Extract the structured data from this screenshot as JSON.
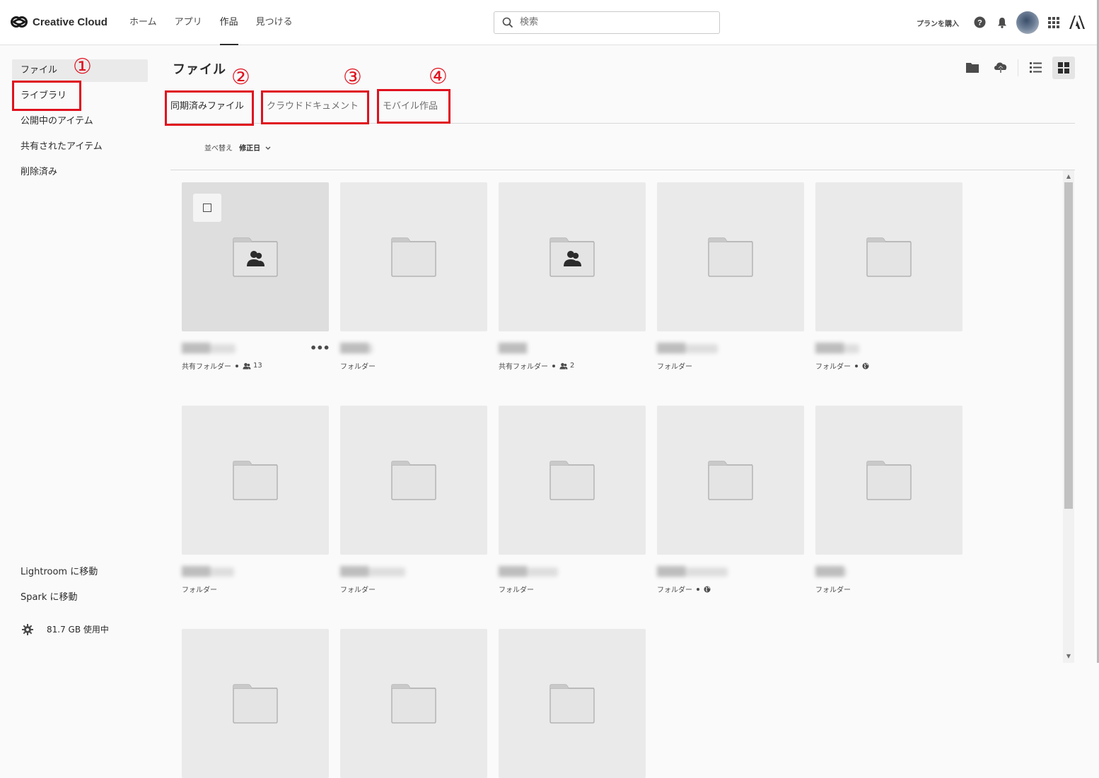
{
  "app": {
    "title": "Creative Cloud",
    "nav": [
      {
        "label": "ホーム",
        "active": false
      },
      {
        "label": "アプリ",
        "active": false
      },
      {
        "label": "作品",
        "active": true
      },
      {
        "label": "見つける",
        "active": false
      }
    ],
    "search_placeholder": "検索",
    "buy_plan_label": "プランを購入",
    "header_icons": [
      "help-icon",
      "bell-icon",
      "avatar",
      "apps-grid-icon",
      "adobe-logo-icon"
    ]
  },
  "sidebar": {
    "items": [
      {
        "label": "ファイル",
        "active": true
      },
      {
        "label": "ライブラリ",
        "active": false
      },
      {
        "label": "公開中のアイテム",
        "active": false
      },
      {
        "label": "共有されたアイテム",
        "active": false
      },
      {
        "label": "削除済み",
        "active": false
      }
    ],
    "bottom_links": [
      {
        "label": "Lightroom に移動"
      },
      {
        "label": "Spark に移動"
      }
    ],
    "storage_label": "81.7 GB 使用中"
  },
  "main": {
    "title": "ファイル",
    "tabs": [
      {
        "label": "同期済みファイル",
        "active": true
      },
      {
        "label": "クラウドドキュメント",
        "active": false
      },
      {
        "label": "モバイル作品",
        "active": false
      }
    ],
    "sort": {
      "label": "並べ替え",
      "value": "修正日"
    },
    "toolbar_icons": [
      "new-folder-icon",
      "upload-icon",
      "list-view-icon",
      "grid-view-icon"
    ],
    "view_mode": "grid"
  },
  "annotations": {
    "colors": {
      "callout": "#e0111e"
    },
    "callouts": [
      "①",
      "②",
      "③",
      "④"
    ]
  },
  "files": [
    {
      "type": "shared",
      "meta": "共有フォルダー",
      "badge": "13",
      "badge_icon": "people-icon",
      "name": "████",
      "selected": true
    },
    {
      "type": "folder",
      "meta": "フォルダー",
      "name": "████"
    },
    {
      "type": "shared",
      "meta": "共有フォルダー",
      "badge": "2",
      "badge_icon": "people-icon",
      "name": "████"
    },
    {
      "type": "folder",
      "meta": "フォルダー",
      "name": "████"
    },
    {
      "type": "folder",
      "meta": "フォルダー",
      "badge_icon": "globe-icon",
      "name": "████"
    },
    {
      "type": "folder",
      "meta": "フォルダー",
      "name": "████"
    },
    {
      "type": "folder",
      "meta": "フォルダー",
      "name": "████"
    },
    {
      "type": "folder",
      "meta": "フォルダー",
      "name": "████"
    },
    {
      "type": "folder",
      "meta": "フォルダー",
      "badge_icon": "globe-icon",
      "name": "████"
    },
    {
      "type": "folder",
      "meta": "フォルダー",
      "name": "████"
    },
    {
      "type": "folder",
      "meta": "",
      "name": ""
    },
    {
      "type": "folder",
      "meta": "",
      "name": ""
    },
    {
      "type": "folder",
      "meta": "",
      "name": ""
    }
  ]
}
